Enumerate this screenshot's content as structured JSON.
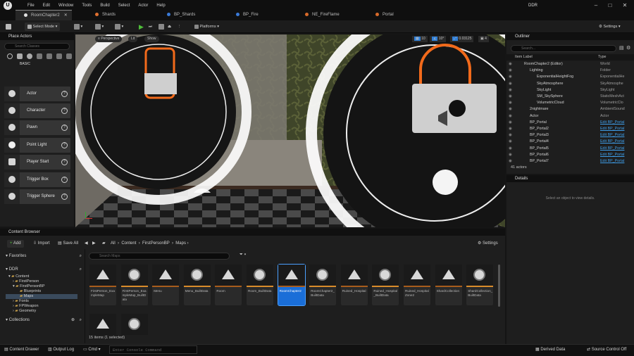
{
  "menu": [
    "File",
    "Edit",
    "Window",
    "Tools",
    "Build",
    "Select",
    "Actor",
    "Help"
  ],
  "project_name": "DDR",
  "tabs": [
    {
      "label": "RoomChapter2",
      "color": "#e0e0e0"
    },
    {
      "label": "Shards",
      "color": "#e07030"
    },
    {
      "label": "BP_Shards",
      "color": "#3a7ad8"
    },
    {
      "label": "BP_Fire",
      "color": "#3a7ad8"
    },
    {
      "label": "NE_FireFlame",
      "color": "#d86a2a"
    },
    {
      "label": "Portal",
      "color": "#d86a2a"
    }
  ],
  "toolbar": {
    "mode": "Select Mode",
    "platforms": "Platforms",
    "settings": "Settings"
  },
  "viewport": {
    "perspective": "Perspective",
    "lit": "Lit",
    "show": "Show",
    "snap_grid": "10",
    "snap_rot": "10°",
    "snap_scale": "0.03125",
    "cam_speed": "4"
  },
  "place_actors": {
    "title": "Place Actors",
    "search_placeholder": "Search Classes",
    "category": "BASIC",
    "items": [
      "Actor",
      "Character",
      "Pawn",
      "Point Light",
      "Player Start",
      "Trigger Box",
      "Trigger Sphere"
    ]
  },
  "outliner": {
    "title": "Outliner",
    "search_placeholder": "Search...",
    "col_label": "Item Label",
    "col_type": "Type",
    "rows": [
      {
        "label": "RoomChapter2 (Editor)",
        "type": "World",
        "link": false
      },
      {
        "label": "Lighting",
        "type": "Folder",
        "link": false
      },
      {
        "label": "ExponentialHeightFog",
        "type": "ExponentialHe",
        "link": false
      },
      {
        "label": "SkyAtmosphere",
        "type": "SkyAtmosphe",
        "link": false
      },
      {
        "label": "SkyLight",
        "type": "SkyLight",
        "link": false
      },
      {
        "label": "SM_SkySphere",
        "type": "StaticMeshAct",
        "link": false
      },
      {
        "label": "VolumetricCloud",
        "type": "VolumetricClo",
        "link": false
      },
      {
        "label": "2nightmare",
        "type": "AmbientSound",
        "link": false
      },
      {
        "label": "Actor",
        "type": "Actor",
        "link": false
      },
      {
        "label": "BP_Portal",
        "type": "Edit BP_Portal",
        "link": true
      },
      {
        "label": "BP_Portal2",
        "type": "Edit BP_Portal",
        "link": true
      },
      {
        "label": "BP_Portal3",
        "type": "Edit BP_Portal",
        "link": true
      },
      {
        "label": "BP_Portal4",
        "type": "Edit BP_Portal",
        "link": true
      },
      {
        "label": "BP_Portal5",
        "type": "Edit BP_Portal",
        "link": true
      },
      {
        "label": "BP_Portal6",
        "type": "Edit BP_Portal",
        "link": true
      },
      {
        "label": "BP_Portal7",
        "type": "Edit BP_Portal",
        "link": true
      }
    ],
    "count": "41 actors"
  },
  "details": {
    "title": "Details",
    "empty": "Select an object to view details."
  },
  "content_browser": {
    "title": "Content Browser",
    "add": "Add",
    "import": "Import",
    "save_all": "Save All",
    "breadcrumb": [
      "All",
      "Content",
      "FirstPersonBP",
      "Maps"
    ],
    "settings": "Settings",
    "favorites": "Favorites",
    "root": "DDR",
    "search_placeholder": "Search Maps",
    "tree": [
      "Content",
      "FirstPerson",
      "FirstPersonBP",
      "Blueprints",
      "Maps",
      "Fonts",
      "FPWeapon",
      "Geometry"
    ],
    "collections": "Collections",
    "assets": [
      {
        "name": "FirstPerson_ExampleMap",
        "icon": "map"
      },
      {
        "name": "FirstPerson_ExampleMap_BuiltData",
        "icon": "data"
      },
      {
        "name": "Menu",
        "icon": "map"
      },
      {
        "name": "Menu_BuiltData",
        "icon": "data"
      },
      {
        "name": "Room",
        "icon": "map"
      },
      {
        "name": "Room_BuiltData",
        "icon": "data"
      },
      {
        "name": "RoomChapter2",
        "icon": "map"
      },
      {
        "name": "RoomChapter2_BuiltData",
        "icon": "data"
      },
      {
        "name": "Ruined_Hospital",
        "icon": "map"
      },
      {
        "name": "Ruined_Hospital_BuiltData",
        "icon": "data"
      },
      {
        "name": "Ruined_HospitalZone2",
        "icon": "map"
      },
      {
        "name": "ShardCollection",
        "icon": "map"
      },
      {
        "name": "ShardCollection_BuiltData",
        "icon": "data"
      },
      {
        "name": "",
        "icon": "map"
      },
      {
        "name": "",
        "icon": "data"
      }
    ],
    "selected_index": 6,
    "status": "15 items (1 selected)"
  },
  "statusbar": {
    "drawer": "Content Drawer",
    "output": "Output Log",
    "cmd": "Cmd",
    "console_placeholder": "Enter Console Command",
    "derived": "Derived Data",
    "source": "Source Control Off"
  }
}
